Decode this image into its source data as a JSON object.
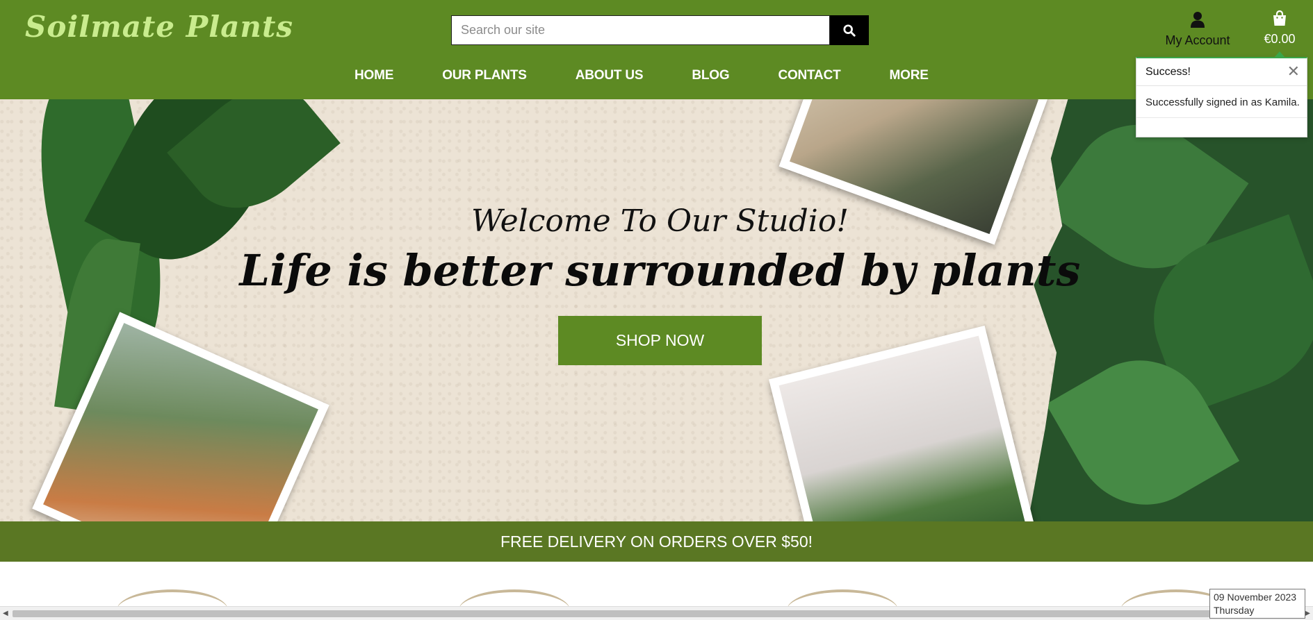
{
  "header": {
    "logo": "Soilmate Plants",
    "search": {
      "placeholder": "Search our site",
      "value": ""
    },
    "account_label": "My Account",
    "bag_total": "€0.00",
    "nav": [
      "HOME",
      "OUR PLANTS",
      "ABOUT US",
      "BLOG",
      "CONTACT",
      "MORE"
    ]
  },
  "toast": {
    "title": "Success!",
    "message": "Successfully signed in as Kamila.",
    "close": "✕"
  },
  "hero": {
    "subtitle": "Welcome To Our Studio!",
    "title": "Life is better surrounded by plants",
    "cta": "SHOP NOW"
  },
  "banner": {
    "text": "FREE DELIVERY ON ORDERS OVER $50!"
  },
  "clock": {
    "date": "09 November 2023",
    "day": "Thursday"
  },
  "colors": {
    "brand_green": "#5d8a23",
    "banner_green": "#5a7723",
    "logo_green": "#c9ec8e",
    "hero_bg": "#ece3d5"
  },
  "icons": [
    "search-icon",
    "user-icon",
    "shopping-bag-icon",
    "close-icon"
  ]
}
